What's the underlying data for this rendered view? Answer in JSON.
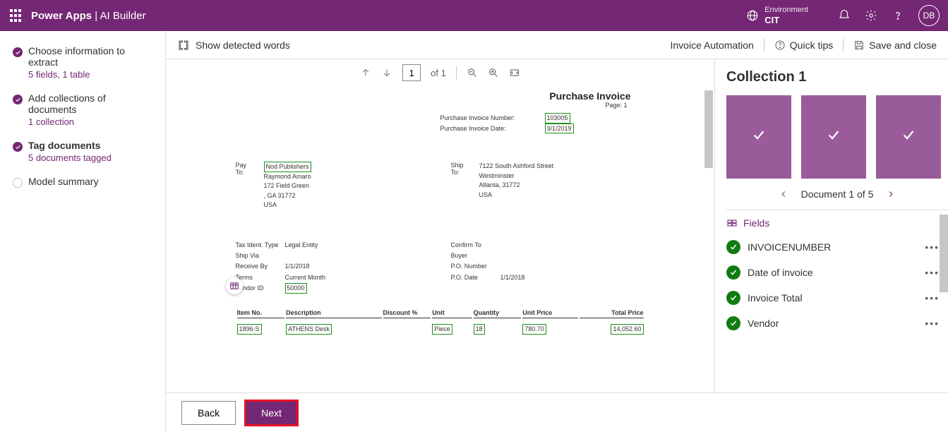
{
  "header": {
    "brand_main": "Power Apps",
    "brand_sep": " | ",
    "brand_sub": "AI Builder",
    "env_label": "Environment",
    "env_name": "CIT",
    "avatar": "DB"
  },
  "sidebar": {
    "steps": [
      {
        "title": "Choose information to extract",
        "sub": "5 fields, 1 table",
        "done": true
      },
      {
        "title": "Add collections of documents",
        "sub": "1 collection",
        "done": true
      },
      {
        "title": "Tag documents",
        "sub": "5 documents tagged",
        "done": true,
        "bold": true
      },
      {
        "title": "Model summary",
        "sub": "",
        "done": false
      }
    ]
  },
  "cmdbar": {
    "show_words": "Show detected words",
    "breadcrumb": "Invoice Automation",
    "quick_tips": "Quick tips",
    "save_close": "Save and close"
  },
  "viewer": {
    "page_current": "1",
    "page_of": "of 1"
  },
  "invoice": {
    "title": "Purchase Invoice",
    "page": "Page: 1",
    "meta": {
      "number_label": "Purchase Invoice Number:",
      "number_value": "103005",
      "date_label": "Purchase Invoice Date:",
      "date_value": "3/1/2019"
    },
    "pay": {
      "lbl": "Pay To:",
      "name": "Nod Publishers",
      "contact": "Raymond Amaro",
      "addr1": "172 Field Green",
      "addr2": ", GA 31772",
      "addr3": "USA"
    },
    "ship": {
      "lbl": "Ship To:",
      "addr1": "7122 South Ashford Street",
      "addr2": "Westminster",
      "addr3": "Atlanta, 31772",
      "addr4": "USA"
    },
    "info_left": {
      "tax_k": "Tax Ident. Type",
      "tax_v": "Legal Entity",
      "shipvia_k": "Ship Via",
      "shipvia_v": "",
      "recv_k": "Receive By",
      "recv_v": "1/1/2018",
      "terms_k": "Terms",
      "terms_v": "Current Month",
      "vendor_k": "Vendor ID",
      "vendor_v": "50000"
    },
    "info_right": {
      "confirm_k": "Confirm To",
      "confirm_v": "",
      "buyer_k": "Buyer",
      "buyer_v": "",
      "pon_k": "P.O. Number",
      "pon_v": "",
      "pod_k": "P.O. Date",
      "pod_v": "1/1/2018"
    },
    "table": {
      "headers": [
        "Item No.",
        "Description",
        "Discount %",
        "Unit",
        "Quantity",
        "Unit Price",
        "Total Price"
      ],
      "row": {
        "item": "1896-S",
        "desc": "ATHENS Desk",
        "disc": "",
        "unit": "Piece",
        "qty": "18",
        "price": "780.70",
        "total": "14,052.60"
      }
    }
  },
  "right": {
    "title": "Collection 1",
    "doc_nav": "Document 1 of 5",
    "fields_label": "Fields",
    "fields": [
      "INVOICENUMBER",
      "Date of invoice",
      "Invoice Total",
      "Vendor"
    ]
  },
  "footer": {
    "back": "Back",
    "next": "Next"
  }
}
